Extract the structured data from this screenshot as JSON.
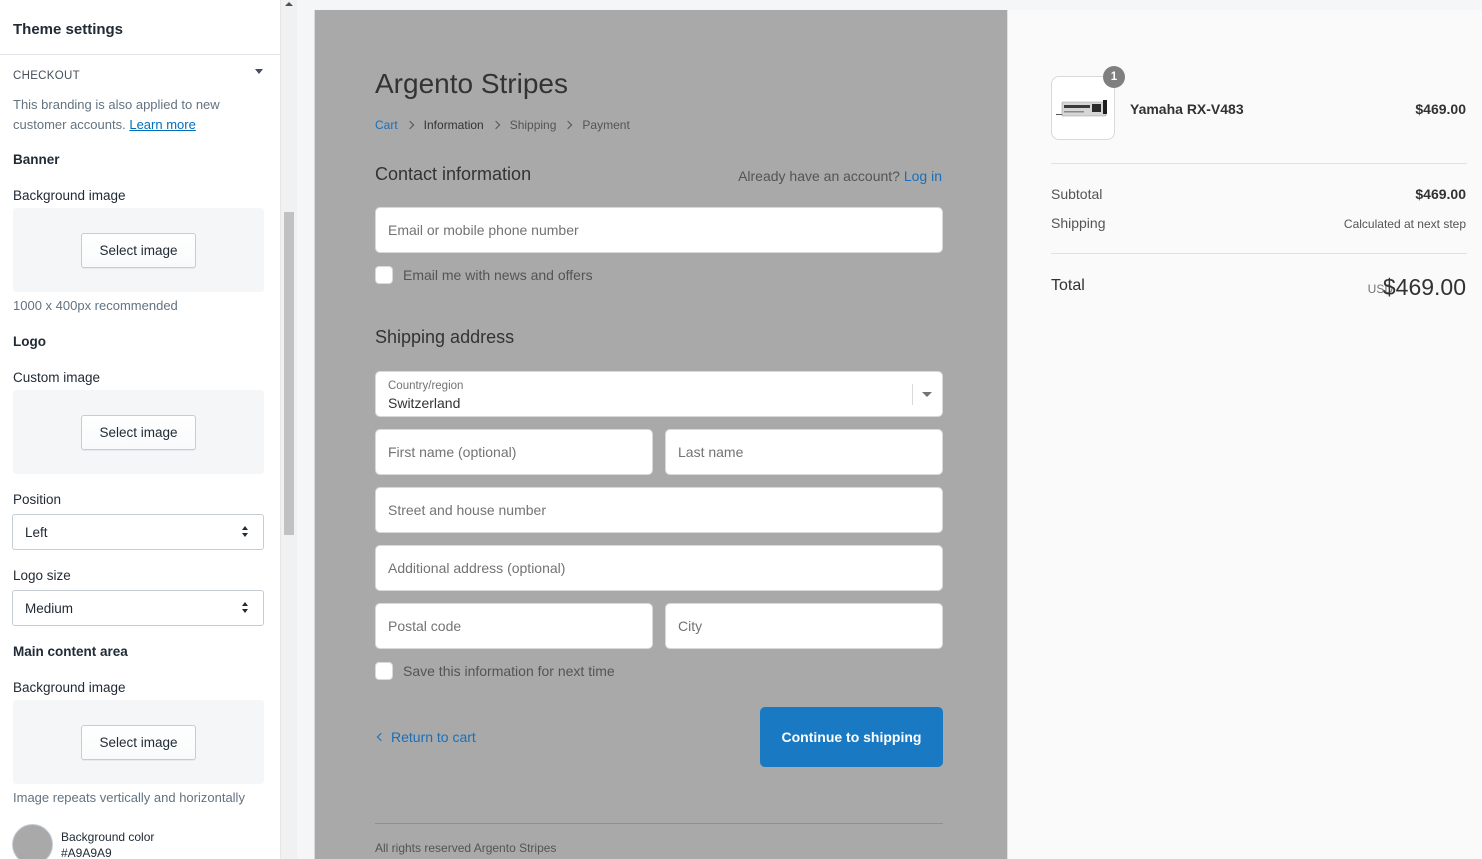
{
  "settings": {
    "title": "Theme settings",
    "section": "CHECKOUT",
    "branding_note": "This branding is also applied to new customer accounts.",
    "learn_more": "Learn more",
    "banner": {
      "heading": "Banner",
      "bg_label": "Background image",
      "button": "Select image",
      "help": "1000 x 400px recommended"
    },
    "logo": {
      "heading": "Logo",
      "custom_label": "Custom image",
      "button": "Select image",
      "position_label": "Position",
      "position_value": "Left",
      "size_label": "Logo size",
      "size_value": "Medium"
    },
    "main_content": {
      "heading": "Main content area",
      "bg_label": "Background image",
      "button": "Select image",
      "help": "Image repeats vertically and horizontally",
      "color_label": "Background color",
      "color_value": "#A9A9A9"
    }
  },
  "checkout": {
    "shop_name": "Argento Stripes",
    "breadcrumb": [
      "Cart",
      "Information",
      "Shipping",
      "Payment"
    ],
    "contact": {
      "title": "Contact information",
      "account_prompt": "Already have an account?",
      "login": "Log in",
      "email_placeholder": "Email or mobile phone number",
      "newsletter": "Email me with news and offers"
    },
    "shipping": {
      "title": "Shipping address",
      "country_label": "Country/region",
      "country_value": "Switzerland",
      "first_name": "First name (optional)",
      "last_name": "Last name",
      "street": "Street and house number",
      "additional": "Additional address (optional)",
      "postal": "Postal code",
      "city": "City",
      "save_info": "Save this information for next time"
    },
    "return_link": "Return to cart",
    "continue_button": "Continue to shipping",
    "footer": "All rights reserved Argento Stripes"
  },
  "summary": {
    "product": {
      "name": "Yamaha RX-V483",
      "price": "$469.00",
      "quantity": "1"
    },
    "subtotal_label": "Subtotal",
    "subtotal_value": "$469.00",
    "shipping_label": "Shipping",
    "shipping_value": "Calculated at next step",
    "total_label": "Total",
    "total_currency": "USD",
    "total_value": "$469.00"
  },
  "colors": {
    "main_background": "#A9A9A9",
    "accent": "#1979C3",
    "link": "#1B6FB8"
  }
}
